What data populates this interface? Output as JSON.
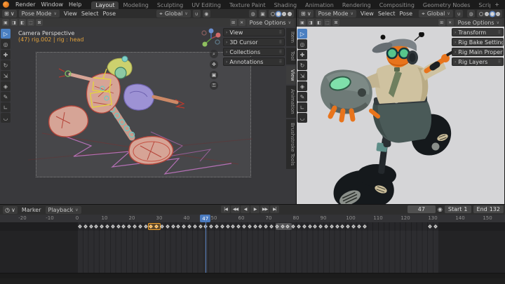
{
  "topbar": {
    "menus": [
      "Render",
      "Window",
      "Help"
    ],
    "workspaces": [
      "Layout",
      "Modeling",
      "Sculpting",
      "UV Editing",
      "Texture Paint",
      "Shading",
      "Animation",
      "Rendering",
      "Compositing",
      "Geometry Nodes",
      "Scripting"
    ],
    "active_workspace": "Layout",
    "add_workspace": "+"
  },
  "icons": {
    "dropdown": "∨",
    "editor_3d": "⊞",
    "editor_timeline": "◷",
    "orientation": "⌖",
    "snap_magnet": "∪",
    "proportional": "◉",
    "overlays": "◍",
    "xray": "▣",
    "grid": "⊞",
    "close": "✕",
    "chevron": "›",
    "drag_dots": "⠿",
    "record": "◉",
    "zoom": "⌕",
    "pan": "✥",
    "camera_view": "▣",
    "lock": "⚿"
  },
  "tools": [
    {
      "name": "select-box-tool",
      "glyph": "▷"
    },
    {
      "name": "cursor-tool",
      "glyph": "◎"
    },
    {
      "name": "move-tool",
      "glyph": "✚"
    },
    {
      "name": "rotate-tool",
      "glyph": "↻"
    },
    {
      "name": "scale-tool",
      "glyph": "⇲"
    },
    {
      "name": "transform-tool",
      "glyph": "◈"
    },
    {
      "name": "annotate-tool",
      "glyph": "✎"
    },
    {
      "name": "measure-tool",
      "glyph": "∟"
    },
    {
      "name": "pose-tool",
      "glyph": "◡"
    }
  ],
  "viewport_left": {
    "mode": "Pose Mode",
    "menus": [
      "View",
      "Select",
      "Pose"
    ],
    "orientation": "Global",
    "options_label": "Pose Options",
    "overlay": {
      "view_label": "Camera Perspective",
      "active_object": "(47) rig.002 | rig : head"
    },
    "sidebar_tabs": [
      "Item",
      "Tool",
      "View",
      "Animation",
      "Brushstroke Tools"
    ],
    "active_sidebar_tab": "View",
    "panels": [
      "View",
      "3D Cursor",
      "Collections",
      "Annotations"
    ]
  },
  "viewport_right": {
    "mode": "Pose Mode",
    "menus": [
      "View",
      "Select",
      "Pose"
    ],
    "orientation": "Global",
    "options_label": "Pose Options",
    "panels": [
      "Transform",
      "Rig Bake Settings",
      "Rig Main Properties",
      "Rig Layers"
    ]
  },
  "timeline": {
    "marker_menu": "Marker",
    "playback_menu": "Playback",
    "transport": [
      {
        "name": "jump-to-start-button",
        "glyph": "|◀"
      },
      {
        "name": "prev-keyframe-button",
        "glyph": "◀◀"
      },
      {
        "name": "play-reverse-button",
        "glyph": "◀"
      },
      {
        "name": "play-button",
        "glyph": "▶"
      },
      {
        "name": "next-keyframe-button",
        "glyph": "▶▶"
      },
      {
        "name": "jump-to-end-button",
        "glyph": "▶|"
      }
    ],
    "current_frame": "47",
    "start_label": "Start",
    "start_frame": "1",
    "end_label": "End",
    "end_frame": "132",
    "frame_range": {
      "start": 0,
      "end": 132
    },
    "ruler_ticks": [
      -20,
      -10,
      0,
      10,
      20,
      30,
      40,
      50,
      60,
      70,
      80,
      90,
      100,
      110,
      120,
      130,
      140,
      150
    ],
    "keyframes": [
      1,
      3,
      5,
      7,
      9,
      11,
      13,
      15,
      17,
      19,
      21,
      23,
      25,
      27,
      29,
      31,
      33,
      35,
      37,
      39,
      41,
      43,
      45,
      47,
      49,
      51,
      53,
      55,
      57,
      59,
      61,
      63,
      65,
      67,
      69,
      71,
      73,
      75,
      77,
      79,
      81,
      83,
      85,
      87,
      89,
      91,
      93,
      95,
      97,
      99,
      101,
      103,
      105,
      129,
      131
    ],
    "selected_keyframes": [
      27,
      29
    ],
    "selected_range": {
      "from": 26,
      "to": 30.5
    },
    "gray_range": {
      "from": 72.5,
      "to": 78.5
    }
  },
  "colors": {
    "accent_blue": "#4a7fc1",
    "playhead_blue": "#5b84c4",
    "selected_orange": "#f0a12c",
    "overlay_orange": "#e0a13c",
    "viewport_dark_bg": "#39393c",
    "camera_view_bg": "#47474a",
    "render_view_bg": "#d5d5d7",
    "rig_select_yellow": "#e3d23f",
    "rig_outline_red": "#b5453a",
    "character_skin_orange": "#e8741c",
    "character_shirt_tan": "#cfc2a0",
    "character_goggles_green": "#57c68c",
    "gauntlet_pad_green": "#7fe0ab",
    "motion_path_pink": "#c878c8"
  }
}
